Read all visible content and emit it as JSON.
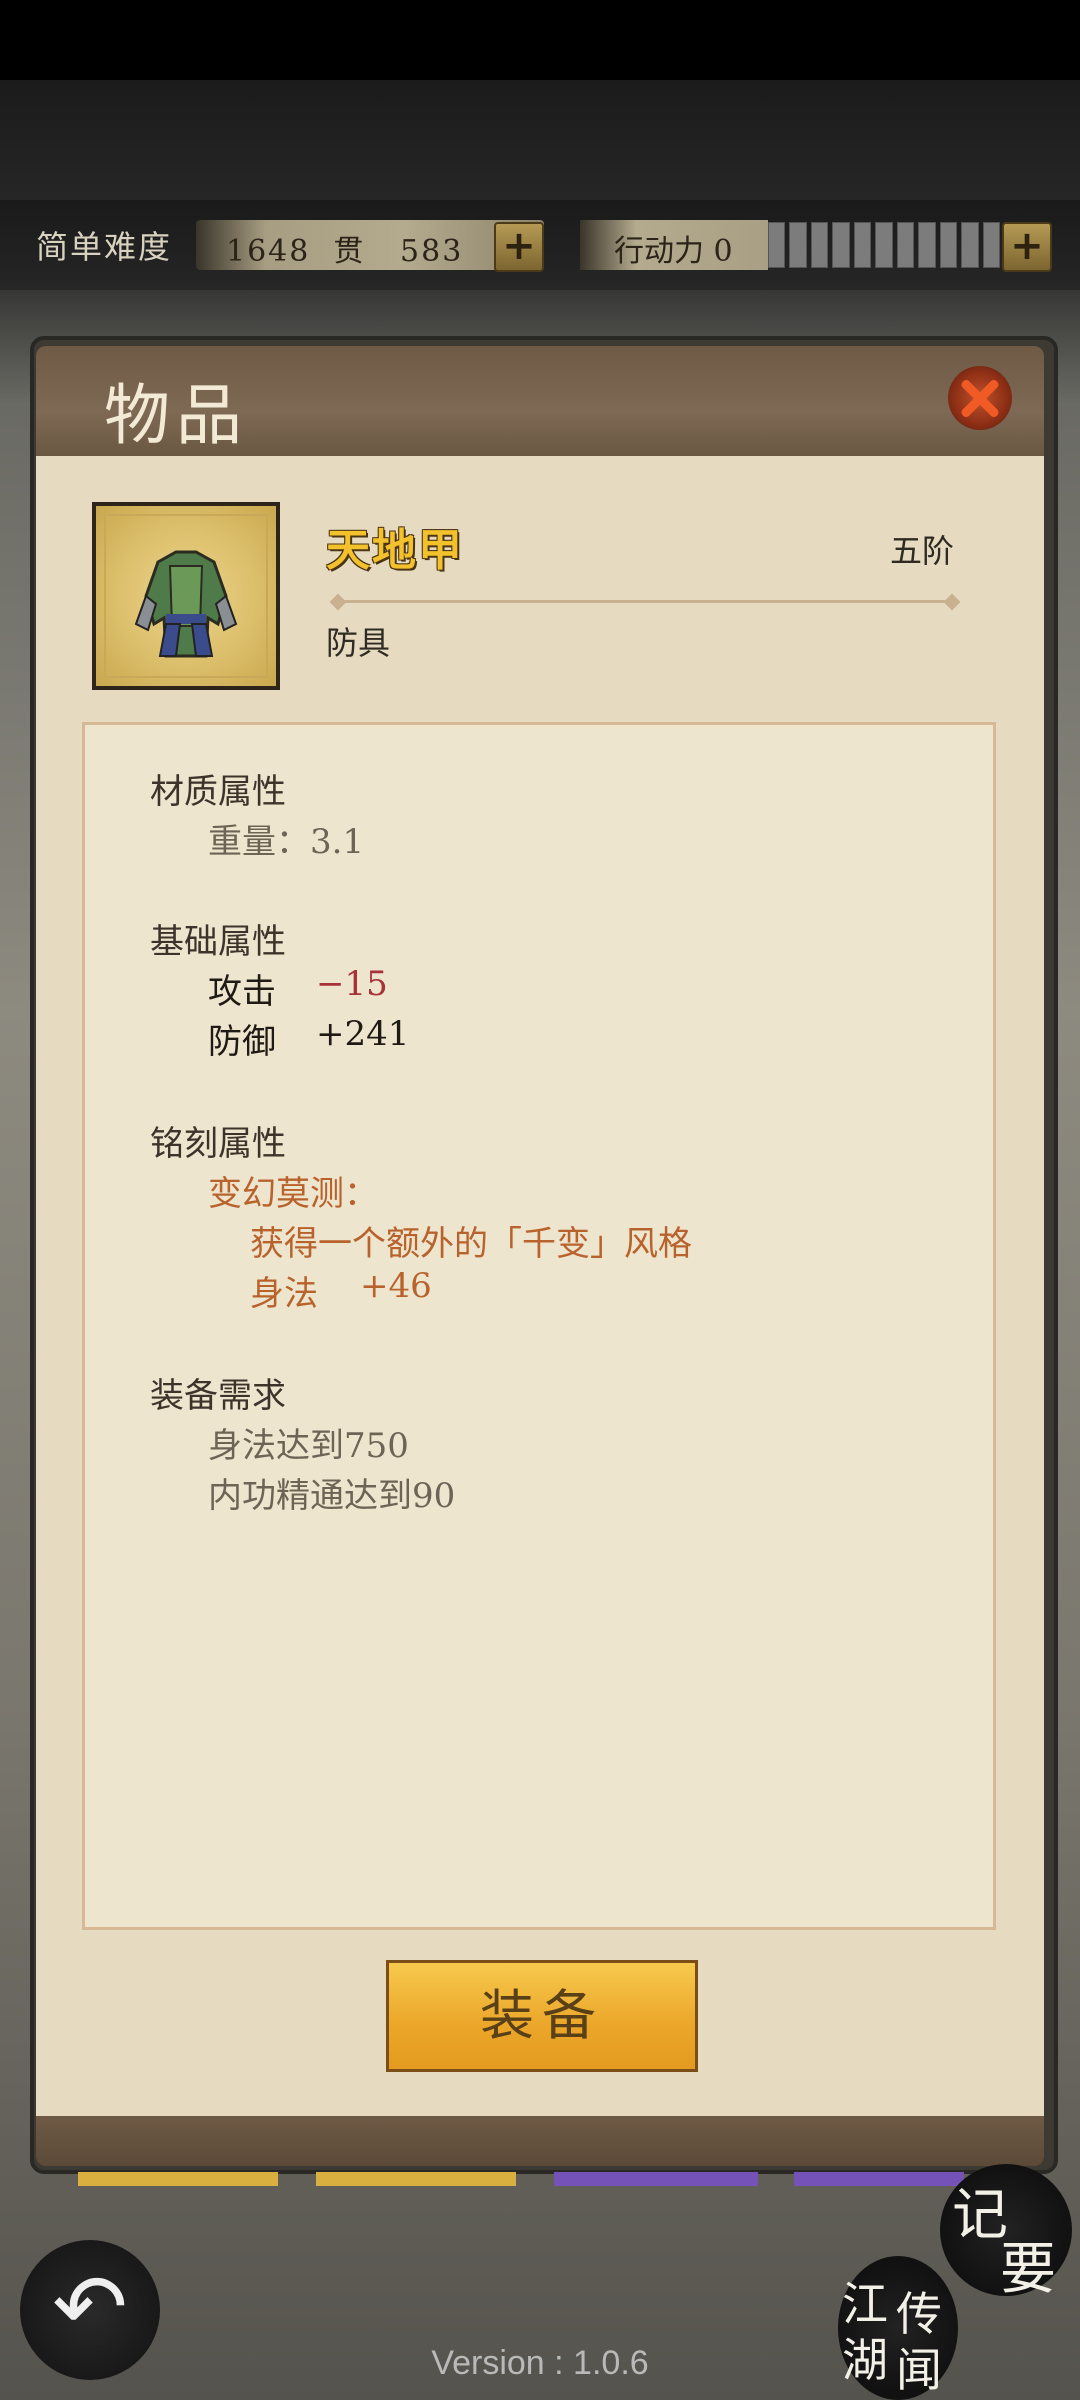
{
  "status": {
    "difficulty": "简单难度",
    "money": "1648  贯   583   文",
    "money_plus": "+",
    "action_label": "行动力 0",
    "action_plus": "+"
  },
  "panel": {
    "title": "物品",
    "item": {
      "name": "天地甲",
      "tier": "五阶",
      "type": "防具",
      "icon": "armor-icon"
    },
    "sections": {
      "material": {
        "title": "材质属性",
        "weight": "重量：3.1"
      },
      "base": {
        "title": "基础属性",
        "attack_label": "攻击",
        "attack_value": "−15",
        "defense_label": "防御",
        "defense_value": "+241"
      },
      "engrave": {
        "title": "铭刻属性",
        "name": "变幻莫测：",
        "desc": "获得一个额外的「千变」风格",
        "stat_label": "身法",
        "stat_value": "+46"
      },
      "requirements": {
        "title": "装备需求",
        "req1": "身法达到750",
        "req2": "内功精通达到90"
      }
    },
    "equip_label": "装备"
  },
  "bottom": {
    "back_icon": "back-arrow-icon",
    "notes_label_1": "记",
    "notes_label_2": "要",
    "legend_1": "江",
    "legend_2": "湖",
    "legend_3": "传",
    "legend_4": "闻",
    "version": "Version : 1.0.6"
  },
  "colors": {
    "accent": "#eba629",
    "header": "#7e6a54",
    "paper": "#e6dbc1",
    "red_value": "#a8313a",
    "orange_text": "#b8622c"
  }
}
